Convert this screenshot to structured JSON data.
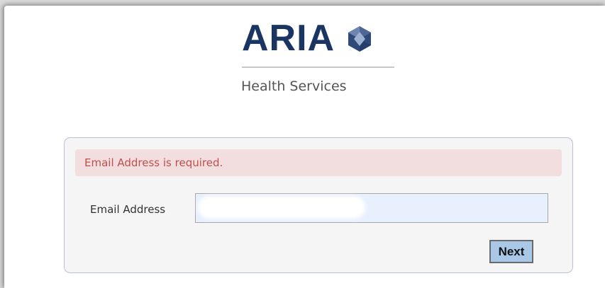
{
  "brand": {
    "name": "ARIA",
    "tagline": "Health Services",
    "logo_icon": "hexagon-gem-icon",
    "colors": {
      "brand_navy": "#1b3563",
      "gem_dark": "#2f4a7a",
      "gem_light": "#9fb1d0"
    }
  },
  "form": {
    "error_message": "Email Address is required.",
    "email_label": "Email Address",
    "email_value": "",
    "next_label": "Next",
    "colors": {
      "error_bg": "#f2dede",
      "error_text": "#c0504d",
      "input_bg": "#e8f0fe",
      "button_bg": "#a9c8e8"
    }
  }
}
